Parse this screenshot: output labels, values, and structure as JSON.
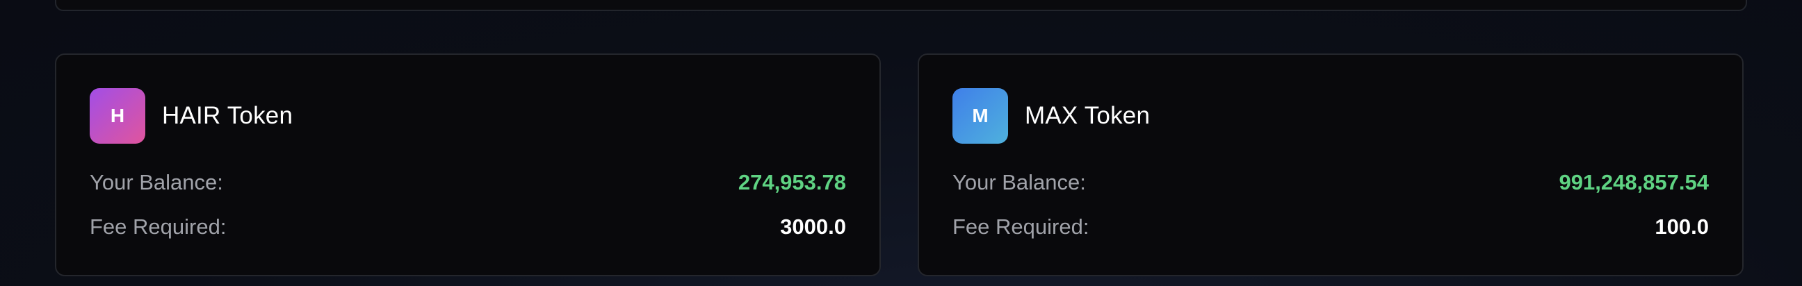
{
  "colors": {
    "balance_value": "#5fd383",
    "fee_value": "#ffffff",
    "label": "#a1a3aa",
    "hair_logo_gradient": [
      "#a24ee6",
      "#e0559d"
    ],
    "max_logo_gradient": [
      "#3f7fe9",
      "#4fb1dd"
    ]
  },
  "tokens": [
    {
      "logo_letter": "H",
      "name": "HAIR Token",
      "balance_label": "Your Balance:",
      "balance_value": "274,953.78",
      "fee_label": "Fee Required:",
      "fee_value": "3000.0"
    },
    {
      "logo_letter": "M",
      "name": "MAX Token",
      "balance_label": "Your Balance:",
      "balance_value": "991,248,857.54",
      "fee_label": "Fee Required:",
      "fee_value": "100.0"
    }
  ]
}
